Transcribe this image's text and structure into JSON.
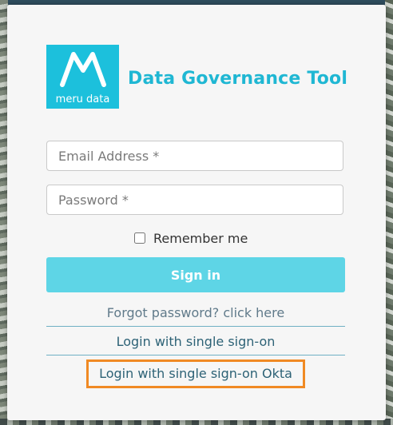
{
  "brand": {
    "logo_text": "meru data",
    "app_title": "Data Governance Tool",
    "accent": "#1cc0dc"
  },
  "form": {
    "email_placeholder": "Email Address *",
    "email_value": "",
    "password_placeholder": "Password *",
    "password_value": "",
    "remember_label": "Remember me",
    "remember_checked": false,
    "signin_label": "Sign in",
    "signin_color": "#5ed5e6"
  },
  "links": {
    "forgot": "Forgot password? click here",
    "sso": "Login with single sign-on",
    "sso_okta": "Login with single sign-on Okta",
    "highlight_color": "#f08a24"
  }
}
